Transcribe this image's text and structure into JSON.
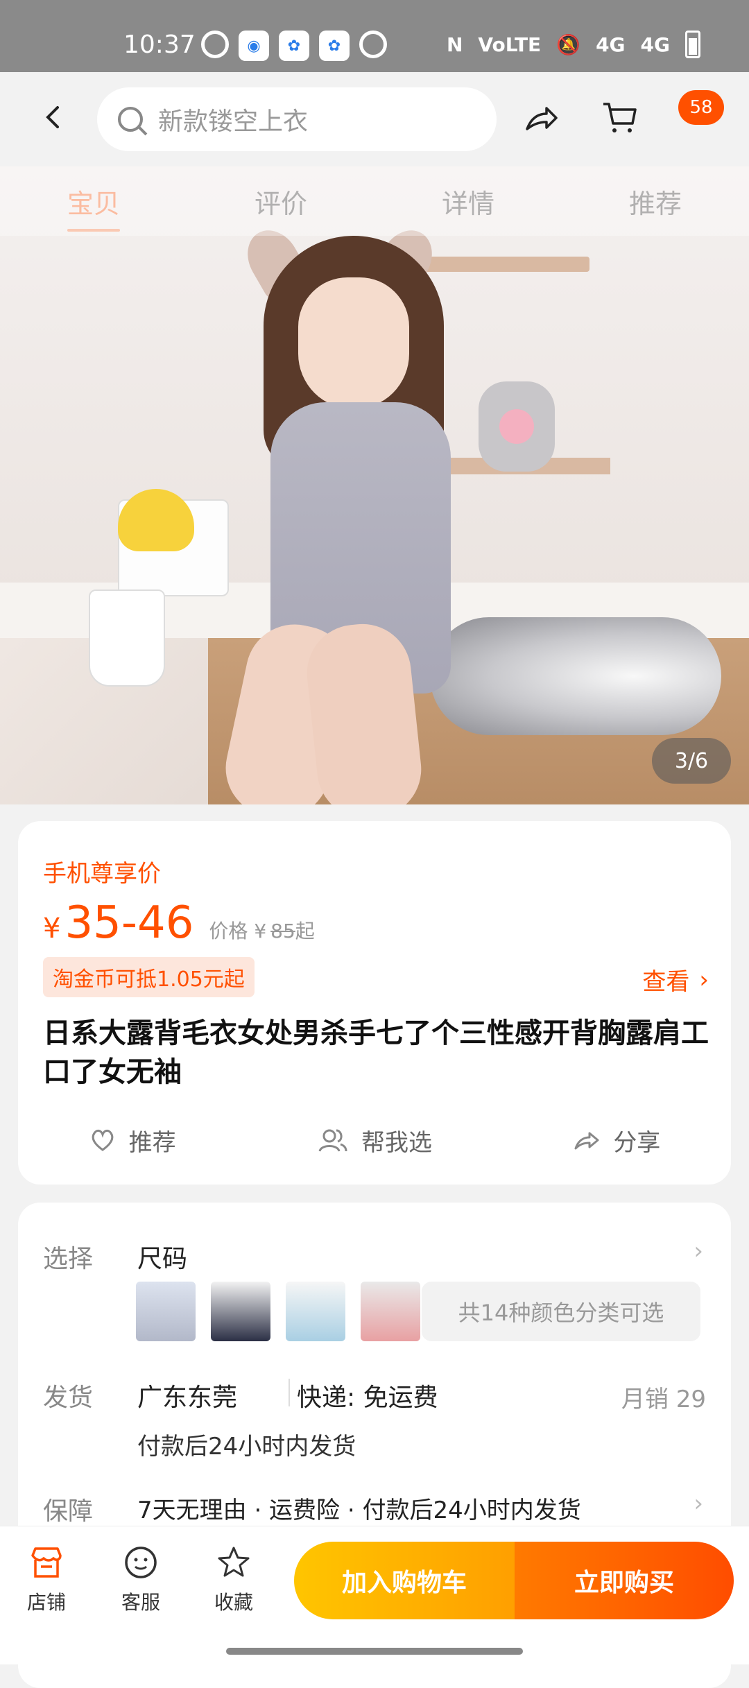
{
  "status": {
    "time": "10:37",
    "network1": "4G",
    "network2": "4G",
    "volte": "VoLTE"
  },
  "header": {
    "search_placeholder": "新款镂空上衣",
    "cart_badge": "58"
  },
  "hero": {
    "tabs": [
      "宝贝",
      "评价",
      "详情",
      "推荐"
    ],
    "active_tab": 0,
    "counter": "3/6"
  },
  "price_card": {
    "promo_label": "手机尊享价",
    "currency": "¥",
    "price": "35-46",
    "orig_label": "价格 ¥",
    "orig_price": "85",
    "orig_suffix": "起",
    "coin_text": "淘金币可抵1.05元起",
    "view_label": "查看",
    "title": "日系大露背毛衣女处男杀手七了个三性感开背胸露肩工口了女无袖",
    "actions": [
      {
        "label": "推荐",
        "icon": "heart-icon"
      },
      {
        "label": "帮我选",
        "icon": "people-icon"
      },
      {
        "label": "分享",
        "icon": "share-icon"
      }
    ]
  },
  "detail_card": {
    "select_label": "选择",
    "select_value": "尺码",
    "colors_text": "共14种颜色分类可选",
    "ship_label": "发货",
    "ship_origin": "广东东莞",
    "ship_method": "快递: 免运费",
    "monthly_sales": "月销  29",
    "ship_time": "付款后24小时内发货",
    "guarantee_label": "保障",
    "guarantee_value": "7天无理由 · 运费险 · 付款后24小时内发货"
  },
  "bottom": {
    "shop": "店铺",
    "service": "客服",
    "favorite": "收藏",
    "add_cart": "加入购物车",
    "buy_now": "立即购买"
  },
  "colors": {
    "accent": "#ff5000",
    "cart_button": "#ffb300",
    "buy_button": "#ff5a00"
  }
}
